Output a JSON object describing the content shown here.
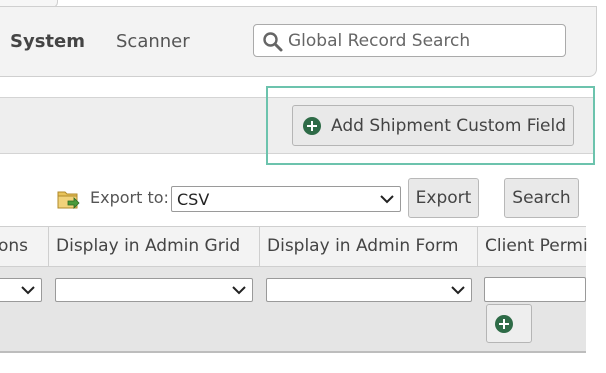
{
  "nav": {
    "items": [
      {
        "label": "System",
        "active": true
      },
      {
        "label": "Scanner",
        "active": false
      }
    ],
    "search": {
      "placeholder": "Global Record Search",
      "value": ""
    }
  },
  "toolbar": {
    "add_button_label": "Add Shipment Custom Field"
  },
  "export": {
    "label": "Export to:",
    "format_selected": "CSV",
    "export_button": "Export",
    "search_button": "Search"
  },
  "grid": {
    "columns": [
      {
        "label": "ons"
      },
      {
        "label": "Display in Admin Grid"
      },
      {
        "label": "Display in Admin Form"
      },
      {
        "label": "Client Permi"
      }
    ]
  },
  "colors": {
    "highlight": "#6cc3ad",
    "plus_icon": "#2e6b47",
    "panel_bg": "#f3f3f3"
  },
  "icons": [
    "search-icon",
    "plus-circle-icon",
    "folder-export-icon",
    "chevron-down-icon"
  ]
}
